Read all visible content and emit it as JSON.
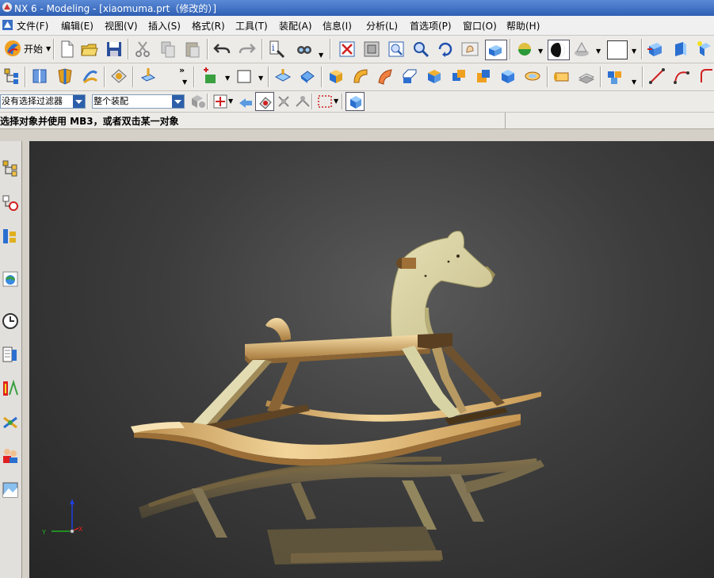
{
  "window": {
    "title": "NX 6 - Modeling - [xiaomuma.prt（修改的）]"
  },
  "menu": {
    "items": [
      {
        "label": "文件(F)"
      },
      {
        "label": "编辑(E)"
      },
      {
        "label": "视图(V)"
      },
      {
        "label": "插入(S)"
      },
      {
        "label": "格式(R)"
      },
      {
        "label": "工具(T)"
      },
      {
        "label": "装配(A)"
      },
      {
        "label": "信息(I)"
      },
      {
        "label": "分析(L)"
      },
      {
        "label": "首选项(P)"
      },
      {
        "label": "窗口(O)"
      },
      {
        "label": "帮助(H)"
      }
    ]
  },
  "toolbar": {
    "start_label": "开始"
  },
  "selection_bar": {
    "filter_value": "没有选择过滤器",
    "scope_value": "整个装配"
  },
  "status": {
    "prompt": "选择对象并使用 MB3，或者双击某一对象"
  },
  "colors": {
    "wood_light": "#e9c98f",
    "wood_mid": "#c99a55",
    "wood_dark": "#7a5a2e",
    "head_light": "#dad5a8",
    "axis_x": "#e02020",
    "axis_y": "#20b020",
    "axis_z": "#2040e0"
  },
  "icons": {
    "resource_bar": [
      "assembly-navigator-icon",
      "constraint-navigator-icon",
      "part-navigator-icon",
      "web-browser-icon",
      "history-icon",
      "reuse-library-icon",
      "system-materials-icon",
      "hd3d-tools-icon",
      "roles-icon",
      "system-scenes-icon"
    ]
  }
}
